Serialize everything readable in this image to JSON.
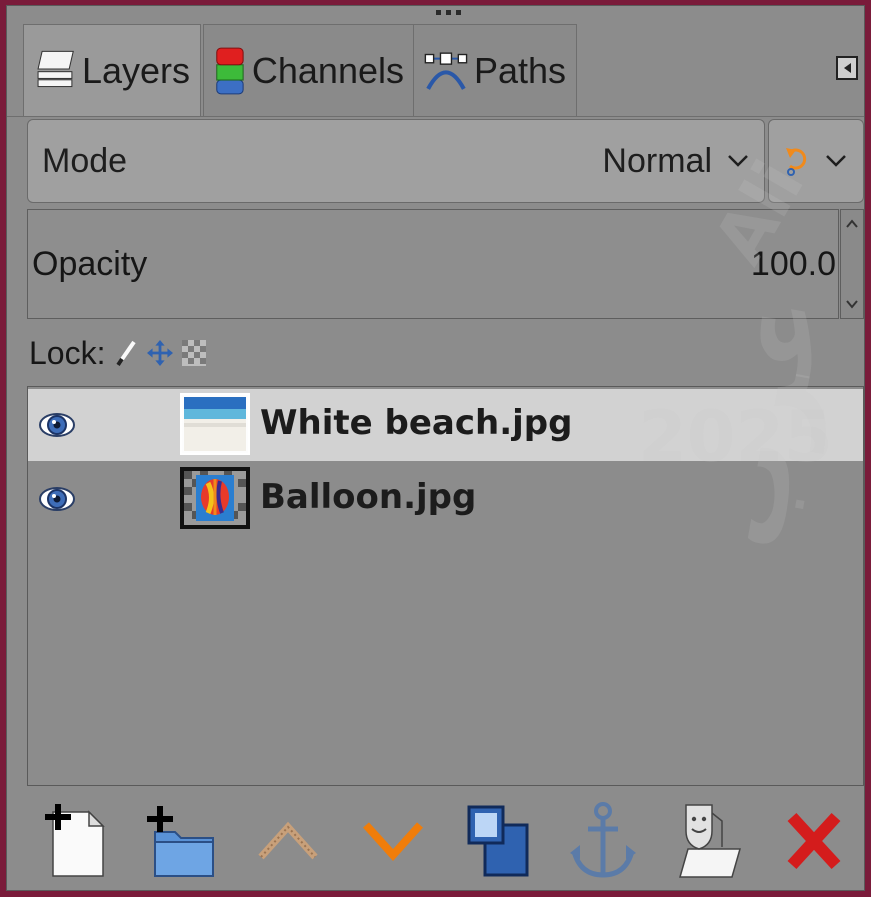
{
  "tabs": [
    {
      "label": "Layers",
      "icon": "layers-icon",
      "active": true
    },
    {
      "label": "Channels",
      "icon": "channels-icon",
      "active": false
    },
    {
      "label": "Paths",
      "icon": "paths-icon",
      "active": false
    }
  ],
  "mode": {
    "label": "Mode",
    "value": "Normal"
  },
  "opacity": {
    "label": "Opacity",
    "value": "100.0"
  },
  "lock": {
    "label": "Lock:"
  },
  "layers": [
    {
      "name": "White beach.jpg",
      "visible": true,
      "selected": true
    },
    {
      "name": "Balloon.jpg",
      "visible": true,
      "selected": false
    }
  ],
  "toolbar": [
    "new-layer-icon",
    "new-layer-group-icon",
    "raise-layer-icon",
    "lower-layer-icon",
    "duplicate-layer-icon",
    "anchor-layer-icon",
    "merge-down-icon",
    "delete-layer-icon"
  ],
  "watermark": {
    "line1": "Ali",
    "line2": "2025",
    "line3": "عرب"
  },
  "colors": {
    "accent_orange": "#f08a1c",
    "delete_red": "#d41c1c",
    "blue": "#2f62b0",
    "frame": "#7a1b3a"
  }
}
